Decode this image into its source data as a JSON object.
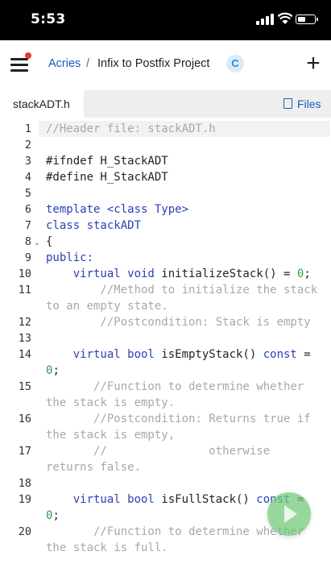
{
  "status_bar": {
    "time": "5:53"
  },
  "header": {
    "breadcrumb_root": "Acries",
    "breadcrumb_separator": "/",
    "breadcrumb_current": "Infix to Postfix Project",
    "language_badge": "C",
    "add_label": "+"
  },
  "tabs": {
    "active_file": "stackADT.h",
    "files_label": "Files"
  },
  "colors": {
    "accent": "#1a5bbf",
    "keyword": "#2a3fb8",
    "comment": "#a8a8a8",
    "number": "#2e9e4a",
    "run_button": "#6ec878",
    "notification_dot": "#e53935"
  },
  "icons": {
    "menu": "hamburger-menu-icon",
    "files": "document-icon",
    "run": "play-icon",
    "fold": "chevron-down-icon"
  },
  "code": {
    "line_numbers": [
      "1",
      "2",
      "3",
      "4",
      "5",
      "6",
      "7",
      "8",
      "9",
      "10",
      "11",
      "12",
      "13",
      "14",
      "15",
      "16",
      "17",
      "18",
      "19",
      "20"
    ],
    "lines": {
      "l1": "//Header file: stackADT.h",
      "l3": "#ifndef H_StackADT",
      "l4": "#define H_StackADT",
      "l6": "template <class Type>",
      "l7": "class stackADT",
      "l8": "{",
      "l9": "public:",
      "l10_kw": "    virtual void",
      "l10_rest": " initializeStack() = ",
      "l10_num": "0",
      "l10_end": ";",
      "l11a": "        //Method to initialize the stack",
      "l11b": "to an empty state.",
      "l12": "        //Postcondition: Stack is empty",
      "l14_kw": "    virtual bool",
      "l14_rest": " isEmptyStack() ",
      "l14_const": "const",
      "l14_eq": " =",
      "l14b_num": "0",
      "l14b_end": ";",
      "l15a": "       //Function to determine whether",
      "l15b": "the stack is empty.",
      "l16a": "       //Postcondition: Returns true if",
      "l16b": "the stack is empty,",
      "l17a": "       //               otherwise",
      "l17b": "returns false.",
      "l19_kw": "    virtual bool",
      "l19_rest": " isFullStack() ",
      "l19_const": "const",
      "l19_eq": " =",
      "l19b_num": "0",
      "l19b_end": ";",
      "l20a": "       //Function to determine whether",
      "l20b": "the stack is full."
    }
  }
}
